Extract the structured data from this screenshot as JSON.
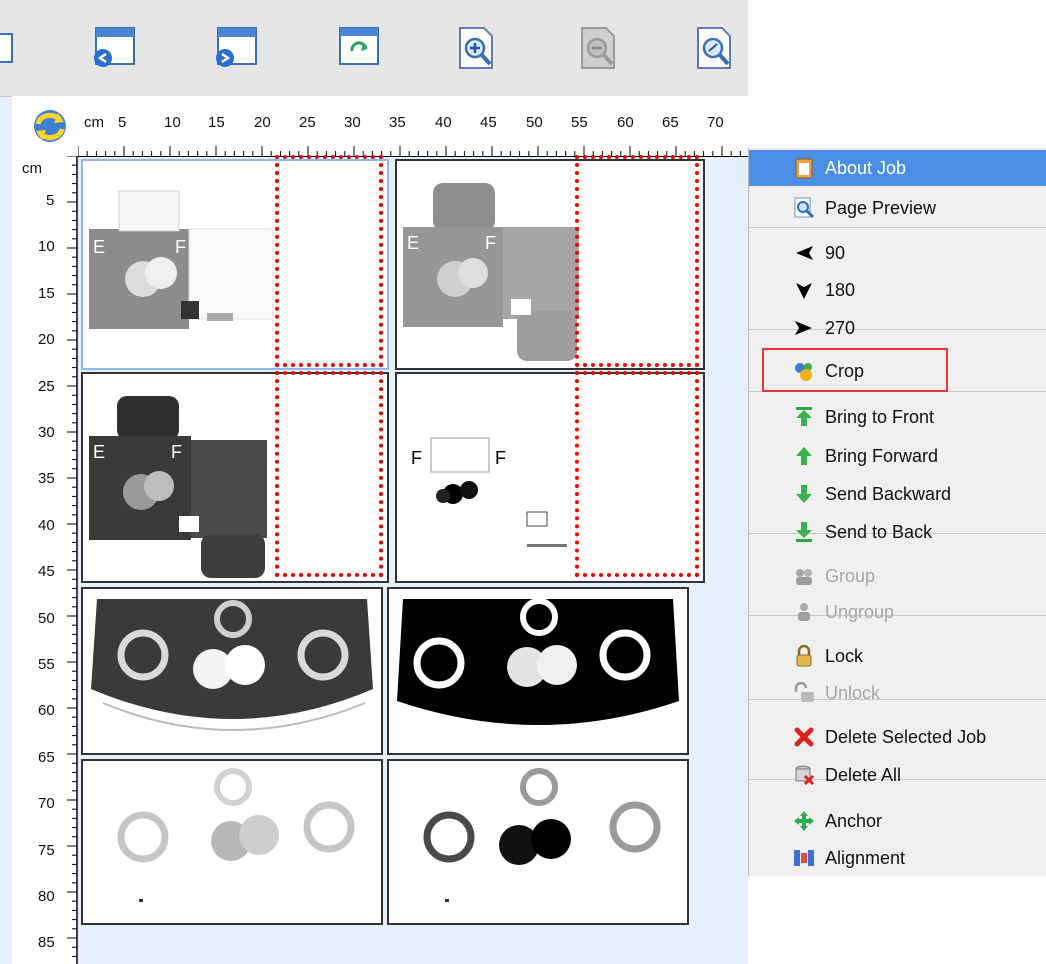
{
  "toolbar": {
    "buttons": [
      "window-back-icon",
      "window-forward-icon",
      "refresh-icon",
      "zoom-in-icon",
      "zoom-out-icon",
      "zoom-fit-icon"
    ]
  },
  "ruler": {
    "unit_h": "cm",
    "h_ticks": [
      "5",
      "10",
      "15",
      "20",
      "25",
      "30",
      "35",
      "40",
      "45",
      "50",
      "55",
      "60",
      "65",
      "70"
    ],
    "unit_v": "cm",
    "v_ticks": [
      "5",
      "10",
      "15",
      "20",
      "25",
      "30",
      "35",
      "40",
      "45",
      "50",
      "55",
      "60",
      "65",
      "70",
      "75",
      "80",
      "85"
    ]
  },
  "jobs": [
    {
      "kind": "box-light"
    },
    {
      "kind": "box-gray"
    },
    {
      "kind": "box-dark"
    },
    {
      "kind": "box-line"
    },
    {
      "kind": "label-dark"
    },
    {
      "kind": "label-black"
    },
    {
      "kind": "label-light"
    },
    {
      "kind": "label-mixed"
    }
  ],
  "menu": {
    "items": [
      {
        "label": "About Job",
        "icon": "clipboard-icon",
        "state": "highlighted"
      },
      {
        "label": "Page Preview",
        "icon": "magnifier-icon",
        "state": "normal"
      },
      {
        "label": "90",
        "icon": "arrow-left-icon",
        "state": "normal"
      },
      {
        "label": "180",
        "icon": "arrow-down-icon",
        "state": "normal"
      },
      {
        "label": "270",
        "icon": "arrow-right-icon",
        "state": "normal"
      },
      {
        "label": "Crop",
        "icon": "crop-icon",
        "state": "normal"
      },
      {
        "label": "Bring to Front",
        "icon": "bring-front-icon",
        "state": "normal"
      },
      {
        "label": "Bring Forward",
        "icon": "bring-forward-icon",
        "state": "normal"
      },
      {
        "label": "Send Backward",
        "icon": "send-backward-icon",
        "state": "normal"
      },
      {
        "label": "Send to Back",
        "icon": "send-back-icon",
        "state": "normal"
      },
      {
        "label": "Group",
        "icon": "group-icon",
        "state": "disabled"
      },
      {
        "label": "Ungroup",
        "icon": "ungroup-icon",
        "state": "disabled"
      },
      {
        "label": "Lock",
        "icon": "lock-icon",
        "state": "normal"
      },
      {
        "label": "Unlock",
        "icon": "unlock-icon",
        "state": "disabled"
      },
      {
        "label": "Delete Selected Job",
        "icon": "delete-icon",
        "state": "normal"
      },
      {
        "label": "Delete All",
        "icon": "delete-all-icon",
        "state": "normal"
      },
      {
        "label": "Anchor",
        "icon": "anchor-icon",
        "state": "normal"
      },
      {
        "label": "Alignment",
        "icon": "alignment-icon",
        "state": "normal"
      }
    ]
  },
  "colors": {
    "highlight": "#4a8ee6",
    "crop_outline": "#e00000",
    "callout": "#e63a3a"
  }
}
